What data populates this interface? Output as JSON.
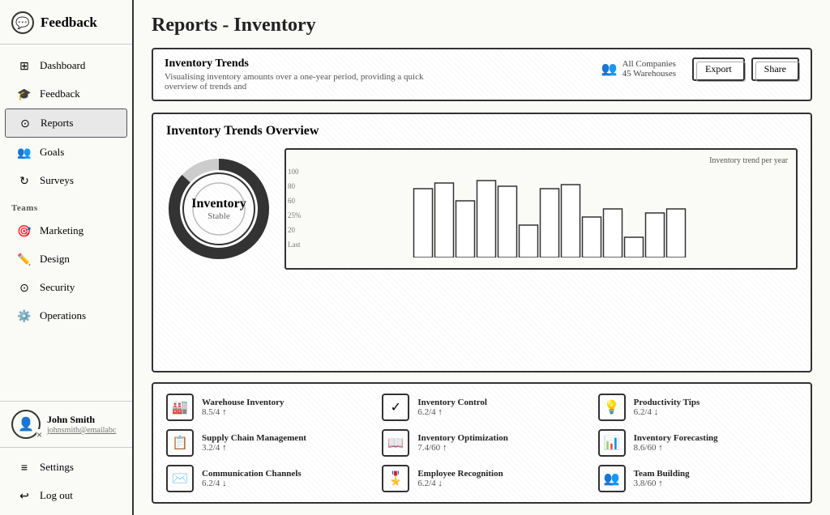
{
  "app": {
    "name": "Feedback"
  },
  "sidebar": {
    "logo_icon": "💬",
    "nav_items": [
      {
        "id": "dashboard",
        "label": "Dashboard",
        "icon": "⊞",
        "active": false
      },
      {
        "id": "feedback",
        "label": "Feedback",
        "icon": "🎓",
        "active": false
      },
      {
        "id": "reports",
        "label": "Reports",
        "icon": "⊙",
        "active": true
      },
      {
        "id": "goals",
        "label": "Goals",
        "icon": "👥",
        "active": false
      },
      {
        "id": "surveys",
        "label": "Surveys",
        "icon": "↻",
        "active": false
      }
    ],
    "teams_label": "Teams",
    "team_items": [
      {
        "id": "marketing",
        "label": "Marketing",
        "icon": "🎯"
      },
      {
        "id": "design",
        "label": "Design",
        "icon": "✏️"
      },
      {
        "id": "security",
        "label": "Security",
        "icon": "⊙"
      },
      {
        "id": "operations",
        "label": "Operations",
        "icon": "⚙️"
      }
    ],
    "user": {
      "name": "John Smith",
      "email": "johnsmith@emailabc"
    },
    "bottom_items": [
      {
        "id": "settings",
        "label": "Settings",
        "icon": "≡"
      },
      {
        "id": "logout",
        "label": "Log out",
        "icon": "↩"
      }
    ]
  },
  "page": {
    "title": "Reports - Inventory"
  },
  "top_card": {
    "title": "Inventory Trends",
    "description": "Visualising inventory amounts over a one-year period, providing a quick overview of trends and",
    "meta_companies": "All Companies",
    "meta_warehouses": "45 Warehouses",
    "export_label": "Export",
    "share_label": "Share"
  },
  "overview": {
    "title": "Inventory Trends Overview",
    "donut_main": "Inventory",
    "donut_sub": "Stable",
    "chart_title": "Inventory trend per year",
    "chart_y_labels": [
      "100",
      "80",
      "60",
      "25%",
      "20",
      "Last"
    ],
    "bars": [
      85,
      92,
      70,
      95,
      88,
      40,
      85,
      90,
      50,
      60,
      25,
      55,
      60
    ]
  },
  "metrics": [
    {
      "id": "warehouse-inventory",
      "name": "Warehouse Inventory",
      "value": "8.5/4",
      "trend": "up",
      "icon": "🏭"
    },
    {
      "id": "inventory-control",
      "name": "Inventory Control",
      "value": "6.2/4",
      "trend": "up",
      "icon": "✓"
    },
    {
      "id": "productivity-tips",
      "name": "Productivity Tips",
      "value": "6.2/4",
      "trend": "down",
      "icon": "💡"
    },
    {
      "id": "supply-chain",
      "name": "Supply Chain Management",
      "value": "3.2/4",
      "trend": "up",
      "icon": "📋"
    },
    {
      "id": "inventory-optimization",
      "name": "Inventory Optimization",
      "value": "7.4/60",
      "trend": "up",
      "icon": "📖"
    },
    {
      "id": "inventory-forecasting",
      "name": "Inventory Forecasting",
      "value": "8.6/60",
      "trend": "up",
      "icon": "📊"
    },
    {
      "id": "communication-channels",
      "name": "Communication Channels",
      "value": "6.2/4",
      "trend": "down",
      "icon": "✉️"
    },
    {
      "id": "employee-recognition",
      "name": "Employee Recognition",
      "value": "6.2/4",
      "trend": "down",
      "icon": "🎖️"
    },
    {
      "id": "team-building",
      "name": "Team Building",
      "value": "3.8/60",
      "trend": "up",
      "icon": "👥"
    }
  ]
}
